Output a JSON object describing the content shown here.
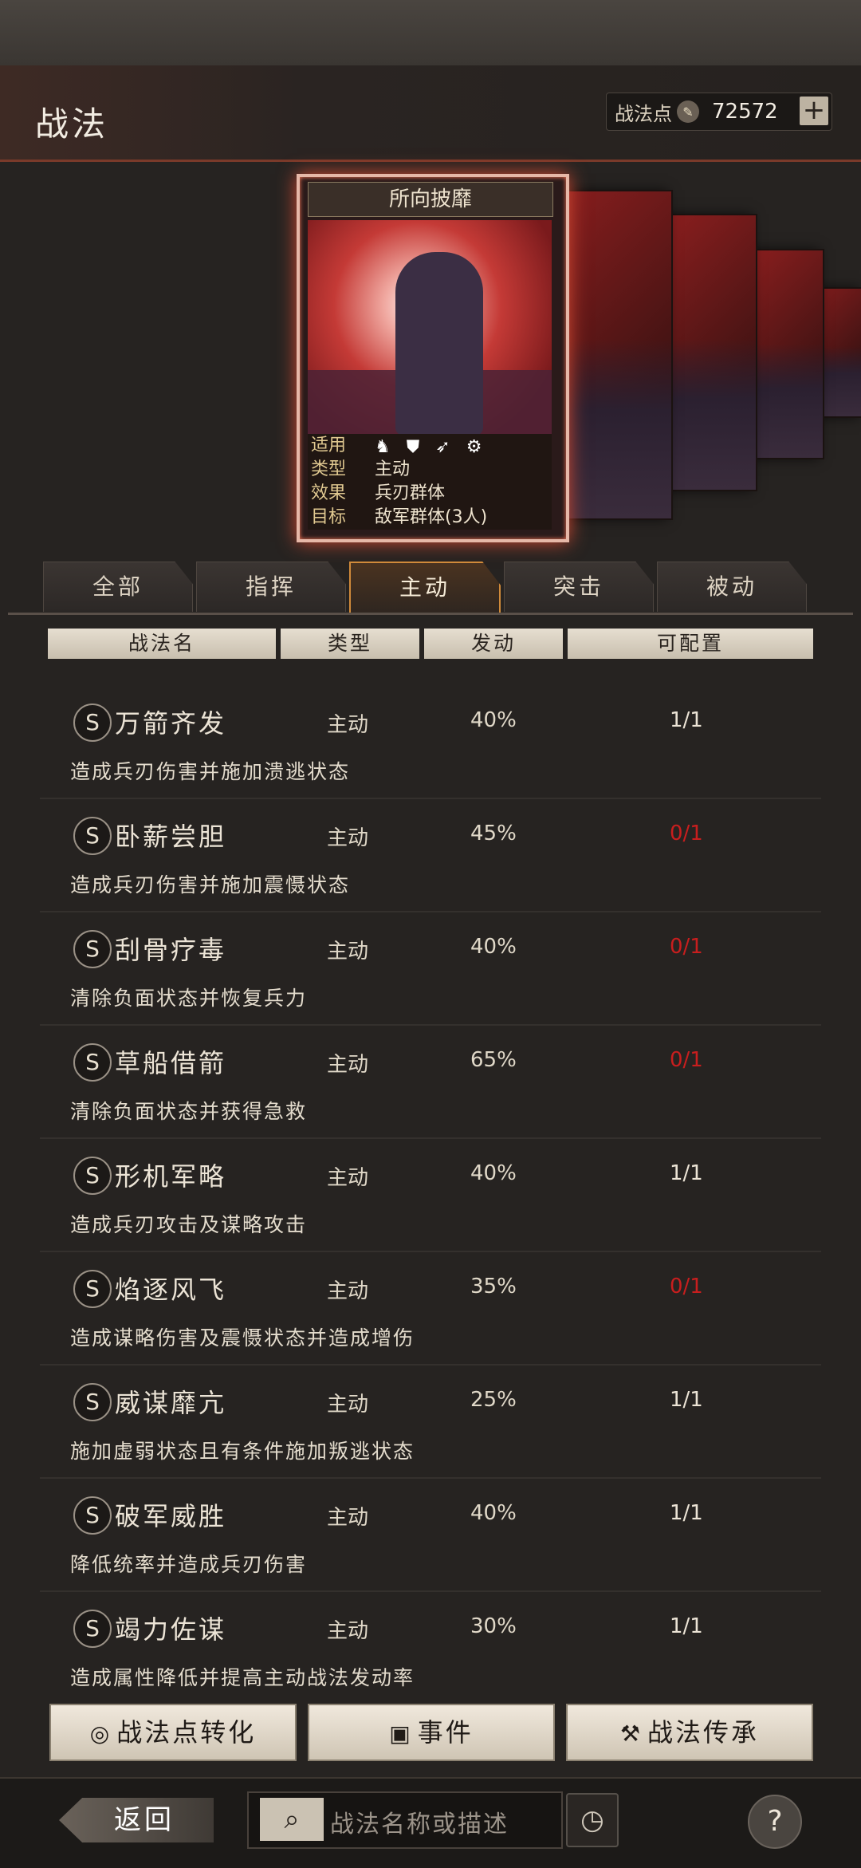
{
  "header": {
    "title": "战法",
    "points_label": "战法点",
    "points_value": "72572",
    "add_label": "+"
  },
  "card": {
    "name": "所向披靡",
    "rows": [
      {
        "key": "适用",
        "value": ""
      },
      {
        "key": "类型",
        "value": "主动"
      },
      {
        "key": "效果",
        "value": "兵刃群体"
      },
      {
        "key": "目标",
        "value": "敌军群体(3人)"
      }
    ]
  },
  "tabs": [
    "全部",
    "指挥",
    "主动",
    "突击",
    "被动"
  ],
  "active_tab": "主动",
  "columns": [
    "战法名",
    "类型",
    "发动",
    "可配置"
  ],
  "tactics": [
    {
      "grade": "S",
      "name": "万箭齐发",
      "type": "主动",
      "rate": "40%",
      "config": "1/1",
      "config_available": true,
      "desc": "造成兵刃伤害并施加溃逃状态"
    },
    {
      "grade": "S",
      "name": "卧薪尝胆",
      "type": "主动",
      "rate": "45%",
      "config": "0/1",
      "config_available": false,
      "desc": "造成兵刃伤害并施加震慑状态"
    },
    {
      "grade": "S",
      "name": "刮骨疗毒",
      "type": "主动",
      "rate": "40%",
      "config": "0/1",
      "config_available": false,
      "desc": "清除负面状态并恢复兵力"
    },
    {
      "grade": "S",
      "name": "草船借箭",
      "type": "主动",
      "rate": "65%",
      "config": "0/1",
      "config_available": false,
      "desc": "清除负面状态并获得急救"
    },
    {
      "grade": "S",
      "name": "形机军略",
      "type": "主动",
      "rate": "40%",
      "config": "1/1",
      "config_available": true,
      "desc": "造成兵刃攻击及谋略攻击"
    },
    {
      "grade": "S",
      "name": "焰逐风飞",
      "type": "主动",
      "rate": "35%",
      "config": "0/1",
      "config_available": false,
      "desc": "造成谋略伤害及震慑状态并造成增伤"
    },
    {
      "grade": "S",
      "name": "威谋靡亢",
      "type": "主动",
      "rate": "25%",
      "config": "1/1",
      "config_available": true,
      "desc": "施加虚弱状态且有条件施加叛逃状态"
    },
    {
      "grade": "S",
      "name": "破军威胜",
      "type": "主动",
      "rate": "40%",
      "config": "1/1",
      "config_available": true,
      "desc": "降低统率并造成兵刃伤害"
    },
    {
      "grade": "S",
      "name": "竭力佐谋",
      "type": "主动",
      "rate": "30%",
      "config": "1/1",
      "config_available": true,
      "desc": "造成属性降低并提高主动战法发动率"
    }
  ],
  "buttons": {
    "convert": "战法点转化",
    "events": "事件",
    "inherit": "战法传承"
  },
  "footer": {
    "back": "返回",
    "search_placeholder": "战法名称或描述",
    "help": "?"
  },
  "colors": {
    "unavailable": "#c81e1e",
    "active_tab_border": "#d08a3a"
  }
}
